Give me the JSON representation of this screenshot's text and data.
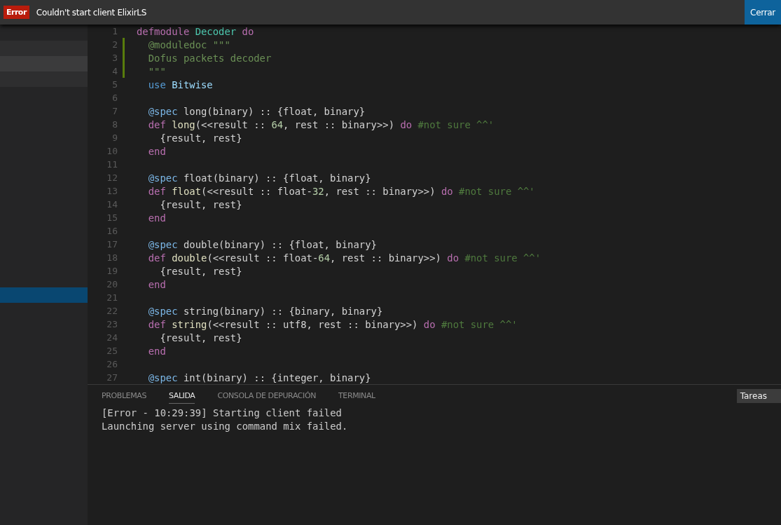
{
  "notification": {
    "badge": "Error",
    "message": "Couldn't start client ElixirLS",
    "button": "Cerrar"
  },
  "sidebar": {
    "items": [
      {
        "kind": "blank"
      },
      {
        "kind": "dim"
      },
      {
        "kind": "lit"
      },
      {
        "kind": "dim"
      },
      {
        "kind": "blank"
      },
      {
        "kind": "blank"
      },
      {
        "kind": "blank"
      },
      {
        "kind": "blank"
      },
      {
        "kind": "blank"
      },
      {
        "kind": "blank"
      },
      {
        "kind": "blank"
      },
      {
        "kind": "blank"
      },
      {
        "kind": "blank"
      },
      {
        "kind": "blank"
      },
      {
        "kind": "blank"
      },
      {
        "kind": "blank"
      },
      {
        "kind": "blank"
      },
      {
        "kind": "selected"
      }
    ]
  },
  "editor": {
    "lines": [
      {
        "number": "1",
        "changed": false,
        "tokens": [
          {
            "kind": "keyword",
            "text": "defmodule"
          },
          {
            "kind": "module",
            "text": " Decoder"
          },
          {
            "kind": "keyword",
            "text": " do"
          }
        ]
      },
      {
        "number": "2",
        "changed": true,
        "tokens": [
          {
            "kind": "doc",
            "text": "  @moduledoc \"\"\""
          }
        ]
      },
      {
        "number": "3",
        "changed": true,
        "tokens": [
          {
            "kind": "doc",
            "text": "  Dofus packets decoder"
          }
        ]
      },
      {
        "number": "4",
        "changed": true,
        "tokens": [
          {
            "kind": "doc",
            "text": "  \"\"\""
          }
        ]
      },
      {
        "number": "5",
        "changed": false,
        "tokens": [
          {
            "kind": "use",
            "text": "  use"
          },
          {
            "kind": "alias",
            "text": " Bitwise"
          }
        ]
      },
      {
        "number": "6",
        "changed": false
      },
      {
        "number": "7",
        "changed": false,
        "tokens": [
          {
            "kind": "attr",
            "text": "  @spec"
          },
          {
            "kind": "text",
            "text": " long(binary) :: {float, binary}"
          }
        ]
      },
      {
        "number": "8",
        "changed": false,
        "tokens": [
          {
            "kind": "keyword",
            "text": "  def"
          },
          {
            "kind": "func",
            "text": " long"
          },
          {
            "kind": "text",
            "text": "(<<result :: "
          },
          {
            "kind": "number",
            "text": "64"
          },
          {
            "kind": "text",
            "text": ", rest :: binary>>) "
          },
          {
            "kind": "keyword",
            "text": "do"
          },
          {
            "kind": "comment",
            "text": " #not sure ^^'"
          }
        ]
      },
      {
        "number": "9",
        "changed": false,
        "tokens": [
          {
            "kind": "text",
            "text": "    {result, rest}"
          }
        ]
      },
      {
        "number": "10",
        "changed": false,
        "tokens": [
          {
            "kind": "keyword",
            "text": "  end"
          }
        ]
      },
      {
        "number": "11",
        "changed": false
      },
      {
        "number": "12",
        "changed": false,
        "tokens": [
          {
            "kind": "attr",
            "text": "  @spec"
          },
          {
            "kind": "text",
            "text": " float(binary) :: {float, binary}"
          }
        ]
      },
      {
        "number": "13",
        "changed": false,
        "tokens": [
          {
            "kind": "keyword",
            "text": "  def"
          },
          {
            "kind": "func",
            "text": " float"
          },
          {
            "kind": "text",
            "text": "(<<result :: float-"
          },
          {
            "kind": "number",
            "text": "32"
          },
          {
            "kind": "text",
            "text": ", rest :: binary>>) "
          },
          {
            "kind": "keyword",
            "text": "do"
          },
          {
            "kind": "comment",
            "text": " #not sure ^^'"
          }
        ]
      },
      {
        "number": "14",
        "changed": false,
        "tokens": [
          {
            "kind": "text",
            "text": "    {result, rest}"
          }
        ]
      },
      {
        "number": "15",
        "changed": false,
        "tokens": [
          {
            "kind": "keyword",
            "text": "  end"
          }
        ]
      },
      {
        "number": "16",
        "changed": false
      },
      {
        "number": "17",
        "changed": false,
        "tokens": [
          {
            "kind": "attr",
            "text": "  @spec"
          },
          {
            "kind": "text",
            "text": " double(binary) :: {float, binary}"
          }
        ]
      },
      {
        "number": "18",
        "changed": false,
        "tokens": [
          {
            "kind": "keyword",
            "text": "  def"
          },
          {
            "kind": "func",
            "text": " double"
          },
          {
            "kind": "text",
            "text": "(<<result :: float-"
          },
          {
            "kind": "number",
            "text": "64"
          },
          {
            "kind": "text",
            "text": ", rest :: binary>>) "
          },
          {
            "kind": "keyword",
            "text": "do"
          },
          {
            "kind": "comment",
            "text": " #not sure ^^'"
          }
        ]
      },
      {
        "number": "19",
        "changed": false,
        "tokens": [
          {
            "kind": "text",
            "text": "    {result, rest}"
          }
        ]
      },
      {
        "number": "20",
        "changed": false,
        "tokens": [
          {
            "kind": "keyword",
            "text": "  end"
          }
        ]
      },
      {
        "number": "21",
        "changed": false
      },
      {
        "number": "22",
        "changed": false,
        "tokens": [
          {
            "kind": "attr",
            "text": "  @spec"
          },
          {
            "kind": "text",
            "text": " string(binary) :: {binary, binary}"
          }
        ]
      },
      {
        "number": "23",
        "changed": false,
        "tokens": [
          {
            "kind": "keyword",
            "text": "  def"
          },
          {
            "kind": "func",
            "text": " string"
          },
          {
            "kind": "text",
            "text": "(<<result :: utf8, rest :: binary>>) "
          },
          {
            "kind": "keyword",
            "text": "do"
          },
          {
            "kind": "comment",
            "text": " #not sure ^^'"
          }
        ]
      },
      {
        "number": "24",
        "changed": false,
        "tokens": [
          {
            "kind": "text",
            "text": "    {result, rest}"
          }
        ]
      },
      {
        "number": "25",
        "changed": false,
        "tokens": [
          {
            "kind": "keyword",
            "text": "  end"
          }
        ]
      },
      {
        "number": "26",
        "changed": false
      },
      {
        "number": "27",
        "changed": false,
        "tokens": [
          {
            "kind": "attr",
            "text": "  @spec"
          },
          {
            "kind": "text",
            "text": " int(binary) :: {integer, binary}"
          }
        ]
      }
    ]
  },
  "panel": {
    "tabs": [
      {
        "label": "PROBLEMAS",
        "selected": false
      },
      {
        "label": "SALIDA",
        "selected": true
      },
      {
        "label": "CONSOLA DE DEPURACIÓN",
        "selected": false
      },
      {
        "label": "TERMINAL",
        "selected": false
      }
    ],
    "dropdown": "Tareas",
    "output": [
      "[Error - 10:29:39] Starting client failed",
      "Launching server using command mix failed."
    ]
  }
}
